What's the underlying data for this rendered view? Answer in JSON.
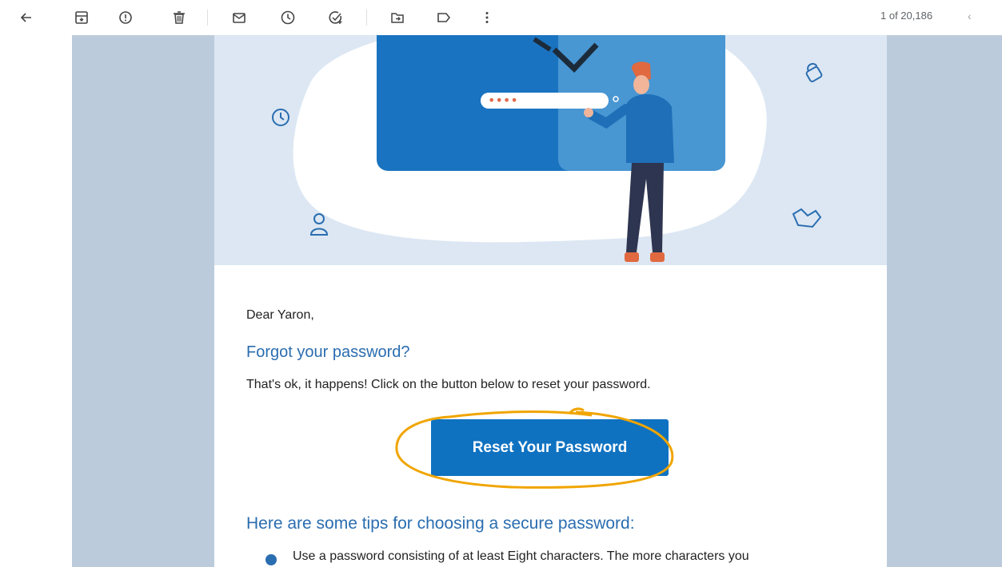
{
  "toolbar": {
    "icons": [
      "back-arrow-icon",
      "archive-icon",
      "report-spam-icon",
      "delete-icon",
      "mark-unread-icon",
      "snooze-icon",
      "add-task-icon",
      "move-to-icon",
      "label-icon",
      "more-icon"
    ],
    "page_count": "1 of 20,186",
    "prev_icon": "chevron-left-icon"
  },
  "email": {
    "greeting": "Dear Yaron,",
    "title": "Forgot your password?",
    "description": "That's ok, it happens! Click on the button below to reset your password.",
    "button_label": "Reset Your Password",
    "tips_title": "Here are some tips for choosing a secure password:",
    "tips": [
      "Use a password consisting of at least Eight characters. The more characters you"
    ],
    "illustration": {
      "password_mask": "••••"
    }
  },
  "colors": {
    "side_panel": "#bccbdc",
    "hero_bg": "#dce7f3",
    "accent": "#2a6db0",
    "button": "#0f72c1",
    "highlight": "#f0a500"
  }
}
